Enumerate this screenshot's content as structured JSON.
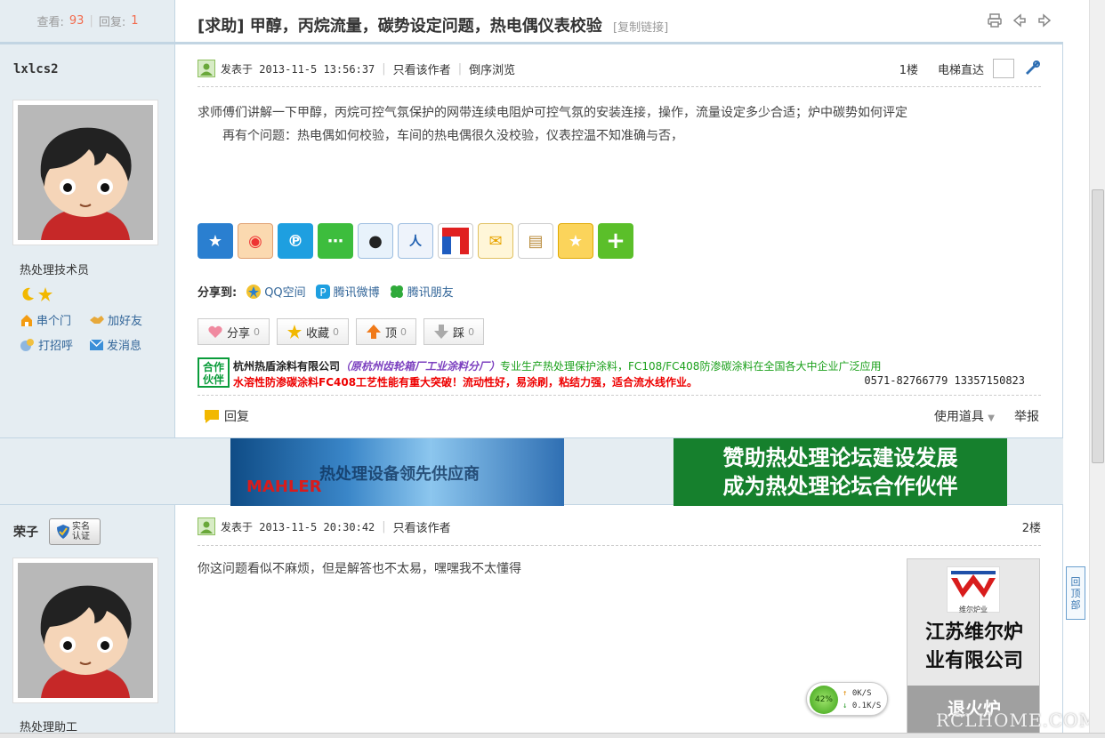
{
  "stats": {
    "views_label": "查看:",
    "views": "93",
    "replies_label": "回复:",
    "replies": "1"
  },
  "thread": {
    "title": "[求助] 甲醇，丙烷流量，碳势设定问题，热电偶仪表校验",
    "copy_link": "[复制链接]"
  },
  "post1": {
    "author": "lxlcs2",
    "user_title": "热处理技术员",
    "links": {
      "friends_door": "串个门",
      "add_friend": "加好友",
      "greet": "打招呼",
      "message": "发消息"
    },
    "posted_at": "发表于 2013-11-5 13:56:37",
    "only_author": "只看该作者",
    "reverse": "倒序浏览",
    "floor": "1楼",
    "elevator": "电梯直达",
    "content_line1": "求师傅们讲解一下甲醇，丙烷可控气氛保护的网带连续电阻炉可控气氛的安装连接，操作，流量设定多少合适；炉中碳势如何评定",
    "content_line2": "再有个问题：热电偶如何校验，车间的热电偶很久没校验，仪表控温不知准确与否，"
  },
  "share": {
    "label": "分享到:",
    "qzone": "QQ空间",
    "weibo": "腾讯微博",
    "pengyou": "腾讯朋友"
  },
  "actions": {
    "share": "分享",
    "share_count": "0",
    "fav": "收藏",
    "fav_count": "0",
    "up": "顶",
    "up_count": "0",
    "down": "踩",
    "down_count": "0"
  },
  "partner": {
    "badge": "合作伙伴",
    "company": "杭州热盾涂料有限公司",
    "original": "（原杭州齿轮箱厂工业涂料分厂）",
    "desc": "专业生产热处理保护涂料，FC108/FC408防渗碳涂料在全国各大中企业广泛应用",
    "line2": "水溶性防渗碳涂料FC408工艺性能有重大突破！流动性好，易涂刷，粘结力强，适合流水线作业。",
    "phone": "0571-82766779 13357150823"
  },
  "reply_row": {
    "reply": "回复",
    "tools": "使用道具",
    "report": "举报"
  },
  "ads": {
    "left_slogan": "热处理设备领先供应商",
    "left_brand": "MAHLER",
    "right_line1": "赞助热处理论坛建设发展",
    "right_line2": "成为热处理论坛合作伙伴"
  },
  "post2": {
    "author": "荣子",
    "badge": "实名认证",
    "user_title": "热处理助工",
    "posted_at": "发表于 2013-11-5 20:30:42",
    "only_author": "只看该作者",
    "floor": "2楼",
    "content": "你这问题看似不麻烦，但是解答也不太易，嘿嘿我不太懂得"
  },
  "side_ad": {
    "logo_caption": "维尔炉业",
    "company_line1": "江苏维尔炉",
    "company_line2": "业有限公司",
    "tag": "退火炉"
  },
  "net": {
    "percent": "42%",
    "up": "0K/S",
    "down": "0.1K/S"
  },
  "back_top": "回顶部",
  "watermark": "RCLHOME.COM"
}
